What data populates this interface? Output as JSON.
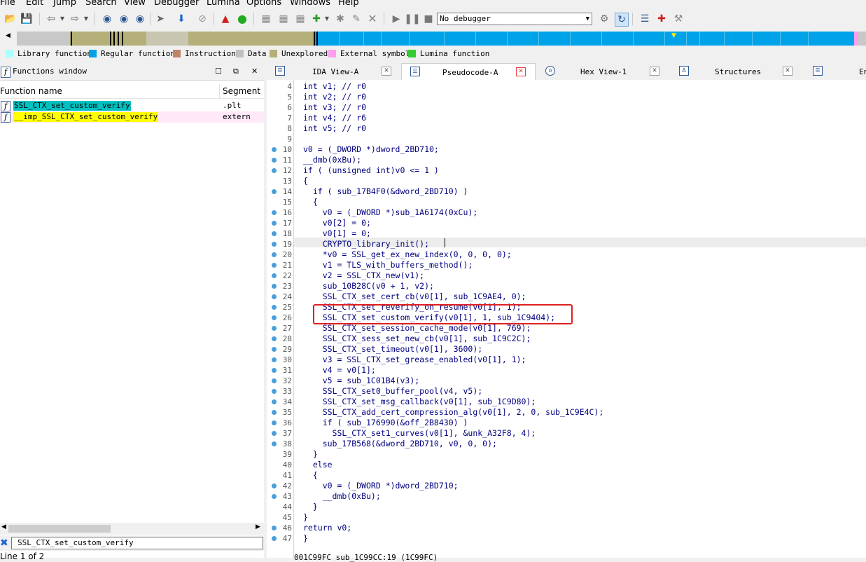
{
  "menu": [
    "File",
    "Edit",
    "Jump",
    "Search",
    "View",
    "Debugger",
    "Lumina",
    "Options",
    "Windows",
    "Help"
  ],
  "toolbar": {
    "debugger_value": "No debugger"
  },
  "legend": [
    {
      "label": "Library function",
      "color": "#aaffff"
    },
    {
      "label": "Regular function",
      "color": "#00a2e8"
    },
    {
      "label": "Instruction",
      "color": "#c0826a"
    },
    {
      "label": "Data",
      "color": "#c0c0c0"
    },
    {
      "label": "Unexplored",
      "color": "#b5b07a"
    },
    {
      "label": "External symbol",
      "color": "#ff9cf0"
    },
    {
      "label": "Lumina function",
      "color": "#33cc33"
    }
  ],
  "functions_window": {
    "title": "Functions window",
    "columns": {
      "name": "Function name",
      "segment": "Segment"
    },
    "rows": [
      {
        "name": "SSL_CTX_set_custom_verify",
        "segment": ".plt",
        "highlight": "#00c0c0"
      },
      {
        "name": "__imp_SSL_CTX_set_custom_verify",
        "segment": "extern",
        "highlight": "#ffff00"
      }
    ],
    "filter_value": "SSL_CTX_set_custom_verify",
    "status": "Line 1 of 2"
  },
  "tabs": [
    {
      "label": "IDA View-A",
      "icon": "disasm-icon",
      "active": false
    },
    {
      "label": "Pseudocode-A",
      "icon": "pseudocode-icon",
      "active": true
    },
    {
      "label": "Hex View-1",
      "icon": "hex-icon",
      "active": false
    },
    {
      "label": "Structures",
      "icon": "structures-icon",
      "active": false
    },
    {
      "label": "En",
      "icon": "enums-icon",
      "active": false
    }
  ],
  "code_lines": [
    {
      "n": "4",
      "text": "int v1; // r0",
      "bp": false
    },
    {
      "n": "5",
      "text": "int v2; // r0",
      "bp": false
    },
    {
      "n": "6",
      "text": "int v3; // r0",
      "bp": false
    },
    {
      "n": "7",
      "text": "int v4; // r6",
      "bp": false
    },
    {
      "n": "8",
      "text": "int v5; // r0",
      "bp": false
    },
    {
      "n": "9",
      "text": "",
      "bp": false
    },
    {
      "n": "10",
      "text": "v0 = (_DWORD *)dword_2BD710;",
      "bp": true
    },
    {
      "n": "11",
      "text": "__dmb(0xBu);",
      "bp": true
    },
    {
      "n": "12",
      "text": "if ( (unsigned int)v0 <= 1 )",
      "bp": true
    },
    {
      "n": "13",
      "text": "{",
      "bp": false
    },
    {
      "n": "14",
      "text": "  if ( sub_17B4F0(&dword_2BD710) )",
      "bp": true
    },
    {
      "n": "15",
      "text": "  {",
      "bp": false
    },
    {
      "n": "16",
      "text": "    v0 = (_DWORD *)sub_1A6174(0xCu);",
      "bp": true
    },
    {
      "n": "17",
      "text": "    v0[2] = 0;",
      "bp": true
    },
    {
      "n": "18",
      "text": "    v0[1] = 0;",
      "bp": true
    },
    {
      "n": "19",
      "text": "    CRYPTO_library_init();",
      "bp": true
    },
    {
      "n": "20",
      "text": "    *v0 = SSL_get_ex_new_index(0, 0, 0, 0);",
      "bp": true
    },
    {
      "n": "21",
      "text": "    v1 = TLS_with_buffers_method();",
      "bp": true
    },
    {
      "n": "22",
      "text": "    v2 = SSL_CTX_new(v1);",
      "bp": true
    },
    {
      "n": "23",
      "text": "    sub_10B28C(v0 + 1, v2);",
      "bp": true
    },
    {
      "n": "24",
      "text": "    SSL_CTX_set_cert_cb(v0[1], sub_1C9AE4, 0);",
      "bp": true
    },
    {
      "n": "25",
      "text": "    SSL_CTX_set_reverify_on_resume(v0[1], 1);",
      "bp": true
    },
    {
      "n": "26",
      "text": "    SSL_CTX_set_custom_verify(v0[1], 1, sub_1C9404);",
      "bp": true
    },
    {
      "n": "27",
      "text": "    SSL_CTX_set_session_cache_mode(v0[1], 769);",
      "bp": true
    },
    {
      "n": "28",
      "text": "    SSL_CTX_sess_set_new_cb(v0[1], sub_1C9C2C);",
      "bp": true
    },
    {
      "n": "29",
      "text": "    SSL_CTX_set_timeout(v0[1], 3600);",
      "bp": true
    },
    {
      "n": "30",
      "text": "    v3 = SSL_CTX_set_grease_enabled(v0[1], 1);",
      "bp": true
    },
    {
      "n": "31",
      "text": "    v4 = v0[1];",
      "bp": true
    },
    {
      "n": "32",
      "text": "    v5 = sub_1C01B4(v3);",
      "bp": true
    },
    {
      "n": "33",
      "text": "    SSL_CTX_set0_buffer_pool(v4, v5);",
      "bp": true
    },
    {
      "n": "34",
      "text": "    SSL_CTX_set_msg_callback(v0[1], sub_1C9D80);",
      "bp": true
    },
    {
      "n": "35",
      "text": "    SSL_CTX_add_cert_compression_alg(v0[1], 2, 0, sub_1C9E4C);",
      "bp": true
    },
    {
      "n": "36",
      "text": "    if ( sub_176990(&off_2B8430) )",
      "bp": true
    },
    {
      "n": "37",
      "text": "      SSL_CTX_set1_curves(v0[1], &unk_A32F8, 4);",
      "bp": true
    },
    {
      "n": "38",
      "text": "    sub_17B568(&dword_2BD710, v0, 0, 0);",
      "bp": true
    },
    {
      "n": "39",
      "text": "  }",
      "bp": false
    },
    {
      "n": "40",
      "text": "  else",
      "bp": false
    },
    {
      "n": "41",
      "text": "  {",
      "bp": false
    },
    {
      "n": "42",
      "text": "    v0 = (_DWORD *)dword_2BD710;",
      "bp": true
    },
    {
      "n": "43",
      "text": "    __dmb(0xBu);",
      "bp": true
    },
    {
      "n": "44",
      "text": "  }",
      "bp": false
    },
    {
      "n": "45",
      "text": "}",
      "bp": false
    },
    {
      "n": "46",
      "text": "return v0;",
      "bp": true
    },
    {
      "n": "47",
      "text": "}",
      "bp": true
    }
  ],
  "bottom_status": "001C99FC sub_1C99CC:19 (1C99FC)"
}
